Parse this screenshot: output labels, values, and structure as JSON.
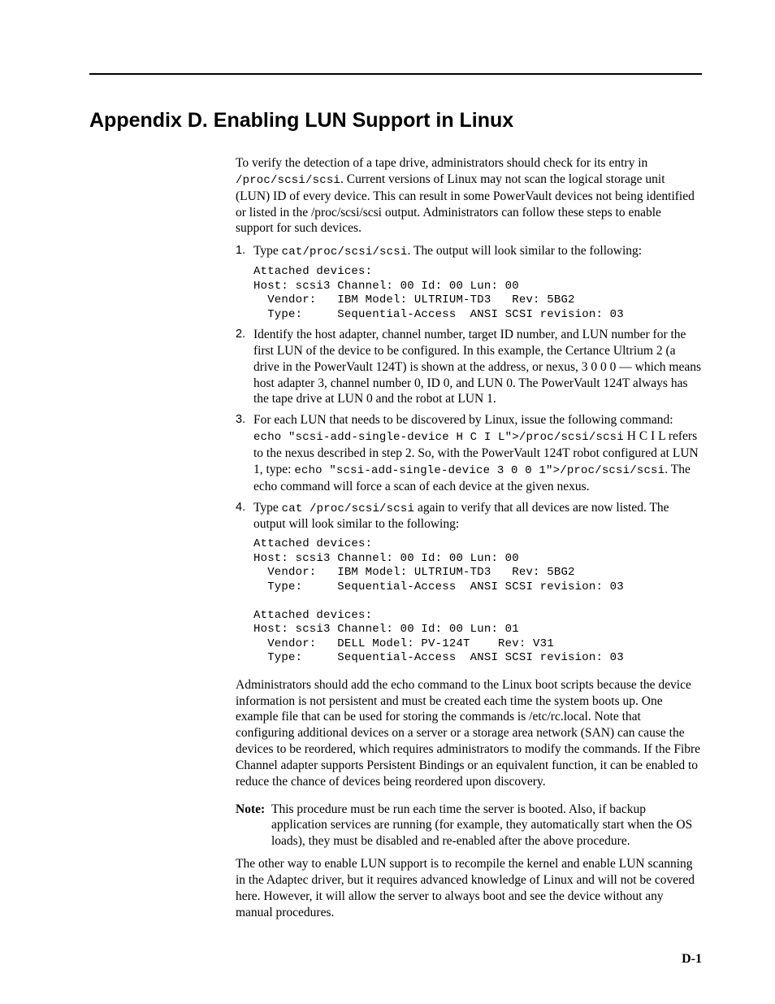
{
  "title": "Appendix D. Enabling LUN Support in Linux",
  "intro_pre": "To verify the detection of a tape drive, administrators should check for its entry in ",
  "intro_code": "/proc/scsi/scsi",
  "intro_post": ". Current versions of Linux may not scan the logical storage unit (LUN) ID of every device. This can result in some PowerVault devices not being identified or listed in the /proc/scsi/scsi output. Administrators can follow these steps to enable support for such devices.",
  "step1": {
    "num": "1.",
    "pre": "Type ",
    "code": "cat/proc/scsi/scsi",
    "post": ". The output will look similar to the following:",
    "block": "Attached devices:\nHost: scsi3 Channel: 00 Id: 00 Lun: 00\n  Vendor:   IBM Model: ULTRIUM-TD3   Rev: 5BG2\n  Type:     Sequential-Access  ANSI SCSI revision: 03"
  },
  "step2": {
    "num": "2.",
    "text": "Identify the host adapter, channel number, target ID number, and LUN number for the first LUN of the device to be configured. In this example, the Certance Ultrium 2 (a drive in the PowerVault 124T) is shown at the address, or nexus, 3 0 0 0 — which means host adapter 3, channel number 0, ID 0, and LUN 0. The PowerVault 124T always has the tape drive at LUN 0 and the robot at LUN 1."
  },
  "step3": {
    "num": "3.",
    "t1": "For each LUN that needs to be discovered by Linux, issue the following command: ",
    "c1": "echo \"scsi-add-single-device H C I L\">/proc/scsi/scsi",
    "t2": " H C I L refers to the nexus described in step 2. So, with the PowerVault 124T robot configured at LUN 1, type: ",
    "c2": "echo \"scsi-add-single-device 3 0 0 1\">/proc/scsi/scsi",
    "t3": ". The echo command will force a scan of each device at the given nexus."
  },
  "step4": {
    "num": "4.",
    "pre": "Type ",
    "code": "cat /proc/scsi/scsi",
    "post": " again to verify that all devices are now listed. The output will look similar to the following:",
    "block": "Attached devices:\nHost: scsi3 Channel: 00 Id: 00 Lun: 00\n  Vendor:   IBM Model: ULTRIUM-TD3   Rev: 5BG2\n  Type:     Sequential-Access  ANSI SCSI revision: 03\n\nAttached devices:\nHost: scsi3 Channel: 00 Id: 00 Lun: 01\n  Vendor:   DELL Model: PV-124T    Rev: V31\n  Type:     Sequential-Access  ANSI SCSI revision: 03"
  },
  "admins_para": "Administrators should add the echo command to the Linux boot scripts because the device information is not persistent and must be created each time the system boots up. One example file that can be used for storing the commands is /etc/rc.local. Note that configuring additional devices on a server or a storage area network (SAN) can cause the devices to be reordered, which requires administrators to modify the commands. If the Fibre Channel adapter supports Persistent Bindings or an equivalent function, it can be enabled to reduce the chance of devices being reordered upon discovery.",
  "note_label": "Note:",
  "note_text": "This procedure must be run each time the server is booted. Also, if backup application services are running (for example, they automatically start when the OS loads), they must be disabled and re-enabled after the above procedure.",
  "closing": "The other way to enable LUN support is to recompile the kernel and enable LUN scanning in the Adaptec driver, but it requires advanced knowledge of Linux and will not be covered here. However, it will allow the server to always boot and see the device without any manual procedures.",
  "page_number": "D-1"
}
